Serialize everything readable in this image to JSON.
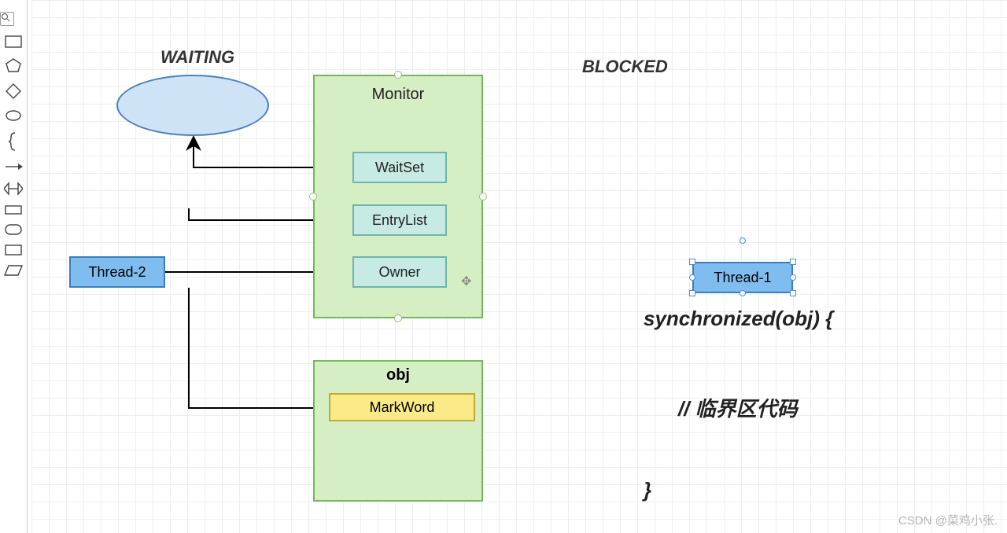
{
  "labels": {
    "waiting": "WAITING",
    "blocked": "BLOCKED"
  },
  "monitor": {
    "title": "Monitor",
    "waitset": "WaitSet",
    "entrylist": "EntryList",
    "owner": "Owner"
  },
  "obj": {
    "title": "obj",
    "markword": "MarkWord"
  },
  "threads": {
    "t1": "Thread-1",
    "t2": "Thread-2"
  },
  "code": {
    "sync": "synchronized(obj) {",
    "comment": "// 临界区代码",
    "close": "}"
  },
  "watermark": "CSDN @菜鸡小张.",
  "search_placeholder": "search",
  "colors": {
    "green_fill": "#d5eec3",
    "green_border": "#72b95a",
    "teal_fill": "#c8eae4",
    "teal_border": "#6cb7a9",
    "yellow_fill": "#fbea88",
    "yellow_border": "#c4a836",
    "blue_fill": "#7fbdf0",
    "blue_border": "#3b7fb8",
    "ellipse_fill": "#cfe3f7",
    "ellipse_border": "#4a82b8"
  }
}
